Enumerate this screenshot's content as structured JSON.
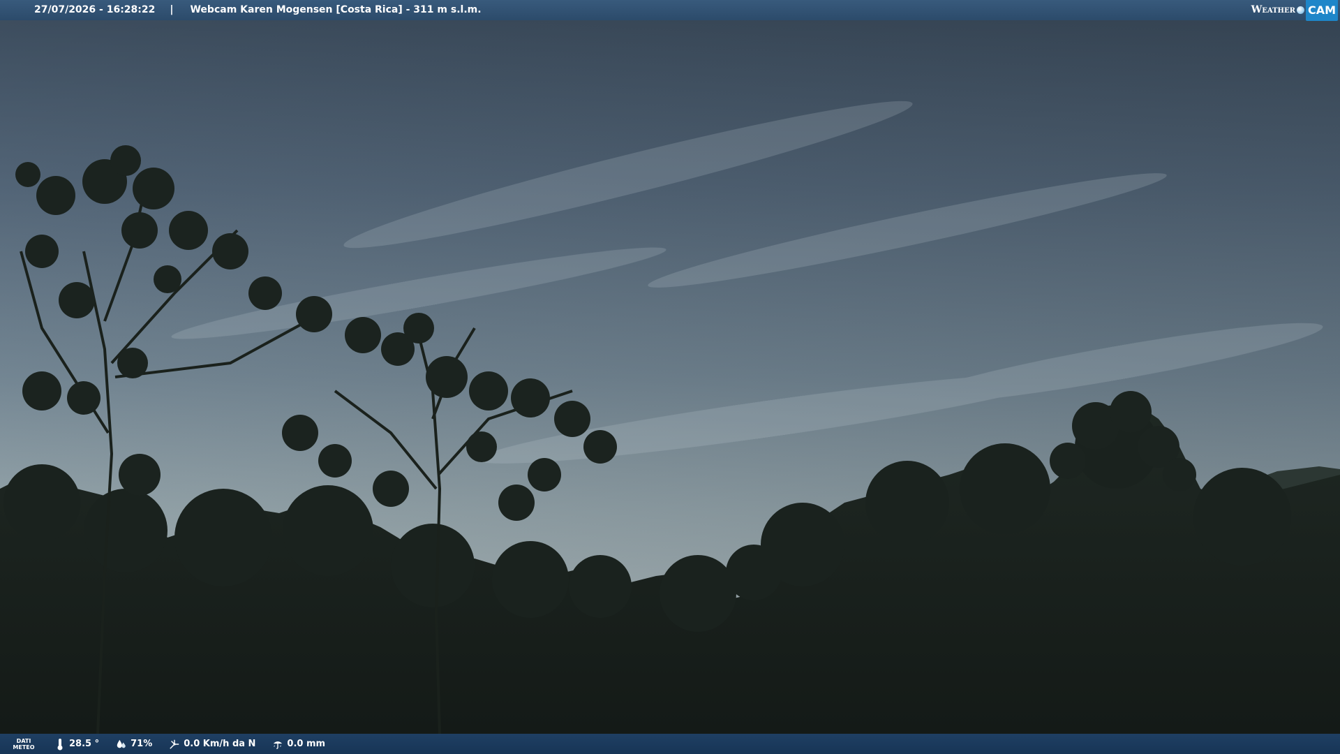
{
  "header": {
    "timestamp": "27/07/2026 - 16:28:22",
    "separator": "|",
    "title": "Webcam Karen Mogensen [Costa Rica]  - 311 m s.l.m.",
    "logo": {
      "weather_text": "Weather",
      "cam_text": "CAM"
    }
  },
  "footer": {
    "dati_line1": "DATI",
    "dati_line2": "METEO",
    "temperature": "28.5 °",
    "humidity": "71%",
    "wind": "0.0 Km/h da N",
    "rain": "0.0 mm"
  },
  "icons": {
    "temperature": "thermometer-icon",
    "humidity": "humidity-icon",
    "wind": "wind-icon",
    "rain": "rain-icon"
  },
  "colors": {
    "header_bar": "#2c4b6b",
    "footer_bar": "#173556",
    "sky_top": "#3d4d5e",
    "sky_horizon": "#b2c1c6",
    "foliage": "#1a211d"
  }
}
